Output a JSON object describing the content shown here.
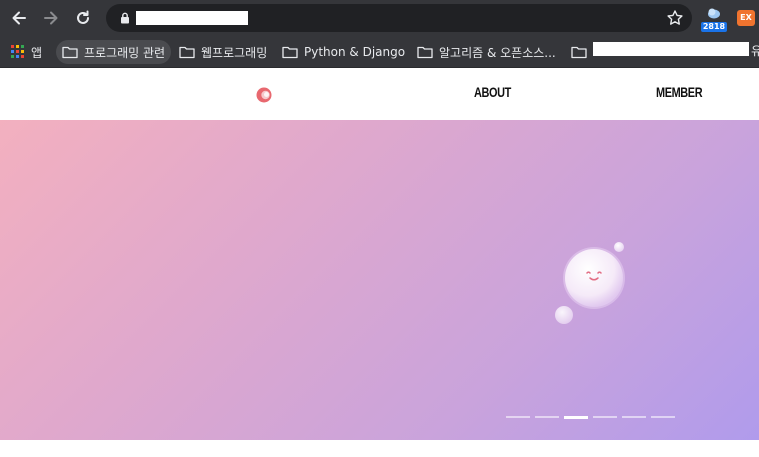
{
  "browser": {
    "bookmarks": [
      {
        "label": "앱",
        "type": "apps"
      },
      {
        "label": "프로그래밍 관련",
        "type": "folder",
        "active": true
      },
      {
        "label": "웹프로그래밍",
        "type": "folder"
      },
      {
        "label": "Python & Django",
        "type": "folder"
      },
      {
        "label": "알고리즘 & 오픈소스...",
        "type": "folder"
      },
      {
        "label": "",
        "type": "folder"
      }
    ],
    "bookmark_tail": "유",
    "extensions": {
      "weather_badge": "2818",
      "ex_label": "EX"
    },
    "colors": {
      "toolbar": "#35363a",
      "omnibox": "#202124"
    }
  },
  "site": {
    "nav": {
      "about": "ABOUT",
      "member": "MEMBER"
    },
    "logo_icon": "circle-logo-icon",
    "hero": {
      "slides": 6,
      "active_slide": 3,
      "gradient_start": "#f3b0bf",
      "gradient_end": "#b09bec"
    }
  }
}
